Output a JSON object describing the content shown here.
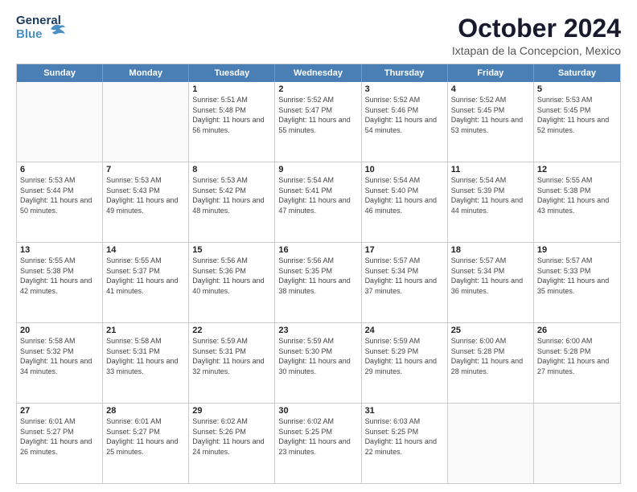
{
  "header": {
    "logo_general": "General",
    "logo_blue": "Blue",
    "month_title": "October 2024",
    "location": "Ixtapan de la Concepcion, Mexico"
  },
  "weekdays": [
    "Sunday",
    "Monday",
    "Tuesday",
    "Wednesday",
    "Thursday",
    "Friday",
    "Saturday"
  ],
  "rows": [
    [
      {
        "date": "",
        "info": ""
      },
      {
        "date": "",
        "info": ""
      },
      {
        "date": "1",
        "info": "Sunrise: 5:51 AM\nSunset: 5:48 PM\nDaylight: 11 hours and 56 minutes."
      },
      {
        "date": "2",
        "info": "Sunrise: 5:52 AM\nSunset: 5:47 PM\nDaylight: 11 hours and 55 minutes."
      },
      {
        "date": "3",
        "info": "Sunrise: 5:52 AM\nSunset: 5:46 PM\nDaylight: 11 hours and 54 minutes."
      },
      {
        "date": "4",
        "info": "Sunrise: 5:52 AM\nSunset: 5:45 PM\nDaylight: 11 hours and 53 minutes."
      },
      {
        "date": "5",
        "info": "Sunrise: 5:53 AM\nSunset: 5:45 PM\nDaylight: 11 hours and 52 minutes."
      }
    ],
    [
      {
        "date": "6",
        "info": "Sunrise: 5:53 AM\nSunset: 5:44 PM\nDaylight: 11 hours and 50 minutes."
      },
      {
        "date": "7",
        "info": "Sunrise: 5:53 AM\nSunset: 5:43 PM\nDaylight: 11 hours and 49 minutes."
      },
      {
        "date": "8",
        "info": "Sunrise: 5:53 AM\nSunset: 5:42 PM\nDaylight: 11 hours and 48 minutes."
      },
      {
        "date": "9",
        "info": "Sunrise: 5:54 AM\nSunset: 5:41 PM\nDaylight: 11 hours and 47 minutes."
      },
      {
        "date": "10",
        "info": "Sunrise: 5:54 AM\nSunset: 5:40 PM\nDaylight: 11 hours and 46 minutes."
      },
      {
        "date": "11",
        "info": "Sunrise: 5:54 AM\nSunset: 5:39 PM\nDaylight: 11 hours and 44 minutes."
      },
      {
        "date": "12",
        "info": "Sunrise: 5:55 AM\nSunset: 5:38 PM\nDaylight: 11 hours and 43 minutes."
      }
    ],
    [
      {
        "date": "13",
        "info": "Sunrise: 5:55 AM\nSunset: 5:38 PM\nDaylight: 11 hours and 42 minutes."
      },
      {
        "date": "14",
        "info": "Sunrise: 5:55 AM\nSunset: 5:37 PM\nDaylight: 11 hours and 41 minutes."
      },
      {
        "date": "15",
        "info": "Sunrise: 5:56 AM\nSunset: 5:36 PM\nDaylight: 11 hours and 40 minutes."
      },
      {
        "date": "16",
        "info": "Sunrise: 5:56 AM\nSunset: 5:35 PM\nDaylight: 11 hours and 38 minutes."
      },
      {
        "date": "17",
        "info": "Sunrise: 5:57 AM\nSunset: 5:34 PM\nDaylight: 11 hours and 37 minutes."
      },
      {
        "date": "18",
        "info": "Sunrise: 5:57 AM\nSunset: 5:34 PM\nDaylight: 11 hours and 36 minutes."
      },
      {
        "date": "19",
        "info": "Sunrise: 5:57 AM\nSunset: 5:33 PM\nDaylight: 11 hours and 35 minutes."
      }
    ],
    [
      {
        "date": "20",
        "info": "Sunrise: 5:58 AM\nSunset: 5:32 PM\nDaylight: 11 hours and 34 minutes."
      },
      {
        "date": "21",
        "info": "Sunrise: 5:58 AM\nSunset: 5:31 PM\nDaylight: 11 hours and 33 minutes."
      },
      {
        "date": "22",
        "info": "Sunrise: 5:59 AM\nSunset: 5:31 PM\nDaylight: 11 hours and 32 minutes."
      },
      {
        "date": "23",
        "info": "Sunrise: 5:59 AM\nSunset: 5:30 PM\nDaylight: 11 hours and 30 minutes."
      },
      {
        "date": "24",
        "info": "Sunrise: 5:59 AM\nSunset: 5:29 PM\nDaylight: 11 hours and 29 minutes."
      },
      {
        "date": "25",
        "info": "Sunrise: 6:00 AM\nSunset: 5:28 PM\nDaylight: 11 hours and 28 minutes."
      },
      {
        "date": "26",
        "info": "Sunrise: 6:00 AM\nSunset: 5:28 PM\nDaylight: 11 hours and 27 minutes."
      }
    ],
    [
      {
        "date": "27",
        "info": "Sunrise: 6:01 AM\nSunset: 5:27 PM\nDaylight: 11 hours and 26 minutes."
      },
      {
        "date": "28",
        "info": "Sunrise: 6:01 AM\nSunset: 5:27 PM\nDaylight: 11 hours and 25 minutes."
      },
      {
        "date": "29",
        "info": "Sunrise: 6:02 AM\nSunset: 5:26 PM\nDaylight: 11 hours and 24 minutes."
      },
      {
        "date": "30",
        "info": "Sunrise: 6:02 AM\nSunset: 5:25 PM\nDaylight: 11 hours and 23 minutes."
      },
      {
        "date": "31",
        "info": "Sunrise: 6:03 AM\nSunset: 5:25 PM\nDaylight: 11 hours and 22 minutes."
      },
      {
        "date": "",
        "info": ""
      },
      {
        "date": "",
        "info": ""
      }
    ]
  ]
}
